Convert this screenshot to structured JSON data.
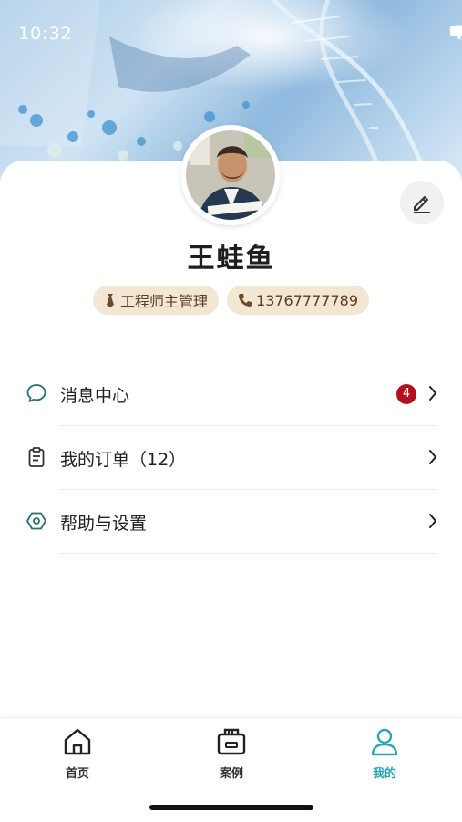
{
  "status": {
    "time": "10:32"
  },
  "profile": {
    "name": "王蛙鱼",
    "role_tag": "工程师主管理",
    "phone_tag": "13767777789"
  },
  "menu": {
    "items": [
      {
        "label": "消息中心",
        "icon": "chat-bubble-icon",
        "badge": "4"
      },
      {
        "label": "我的订单（12）",
        "icon": "clipboard-icon"
      },
      {
        "label": "帮助与设置",
        "icon": "hexagon-settings-icon"
      }
    ]
  },
  "tabbar": {
    "tabs": [
      {
        "label": "首页",
        "icon": "home-icon"
      },
      {
        "label": "案例",
        "icon": "case-icon"
      },
      {
        "label": "我的",
        "icon": "user-icon",
        "active": true
      }
    ]
  },
  "colors": {
    "accent": "#2aa6b8",
    "badge": "#b3101b",
    "tag_bg": "#f3e6d3"
  }
}
